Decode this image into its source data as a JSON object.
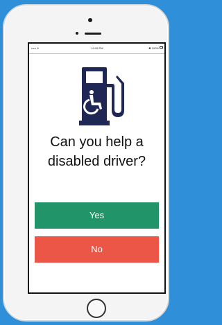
{
  "status_bar": {
    "carrier": "••••• ✈",
    "time": "10:05 PM",
    "battery": "✱ 100%"
  },
  "prompt": {
    "question": "Can you help a disabled driver?"
  },
  "actions": {
    "yes_label": "Yes",
    "no_label": "No"
  },
  "icons": {
    "pump": "fuel-pump-icon",
    "wheelchair": "wheelchair-icon"
  },
  "colors": {
    "background": "#2f8fd8",
    "pump": "#1f2854",
    "yes": "#22946a",
    "no": "#ec5646"
  }
}
